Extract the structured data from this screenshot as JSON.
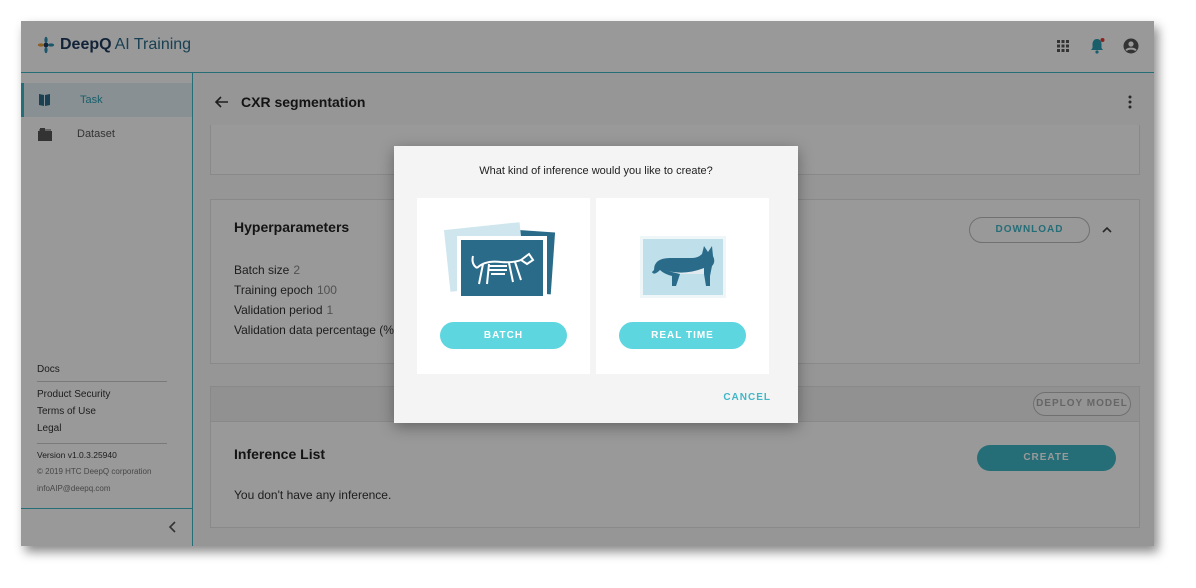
{
  "app": {
    "brand_bold": "DeepQ",
    "brand_rest": "AI Training"
  },
  "topbar": {
    "icons": [
      "apps-grid-icon",
      "notification-bell-icon",
      "account-circle-icon"
    ]
  },
  "sidebar": {
    "items": [
      {
        "label": "Task",
        "icon": "book-icon",
        "active": true
      },
      {
        "label": "Dataset",
        "icon": "folder-stack-icon",
        "active": false
      }
    ],
    "links": [
      "Docs",
      "Product Security",
      "Terms of Use",
      "Legal"
    ],
    "version": "Version v1.0.3.25940",
    "copyright": "© 2019 HTC DeepQ corporation",
    "email": "infoAIP@deepq.com"
  },
  "page": {
    "title": "CXR segmentation"
  },
  "hyperparameters": {
    "title": "Hyperparameters",
    "download_label": "DOWNLOAD",
    "rows": [
      {
        "label": "Batch size",
        "value": "2"
      },
      {
        "label": "Training epoch",
        "value": "100"
      },
      {
        "label": "Validation period",
        "value": "1"
      },
      {
        "label": "Validation data percentage (%",
        "value": ""
      }
    ]
  },
  "deploy": {
    "label": "DEPLOY MODEL"
  },
  "inference": {
    "title": "Inference List",
    "create_label": "CREATE",
    "empty_text": "You don't have any inference."
  },
  "dialog": {
    "title": "What kind of inference would you like to create?",
    "batch_label": "BATCH",
    "realtime_label": "REAL TIME",
    "cancel_label": "CANCEL"
  },
  "colors": {
    "accent": "#3fb7c7",
    "option_button": "#5dd6df",
    "brand": "#1e3a5c"
  }
}
